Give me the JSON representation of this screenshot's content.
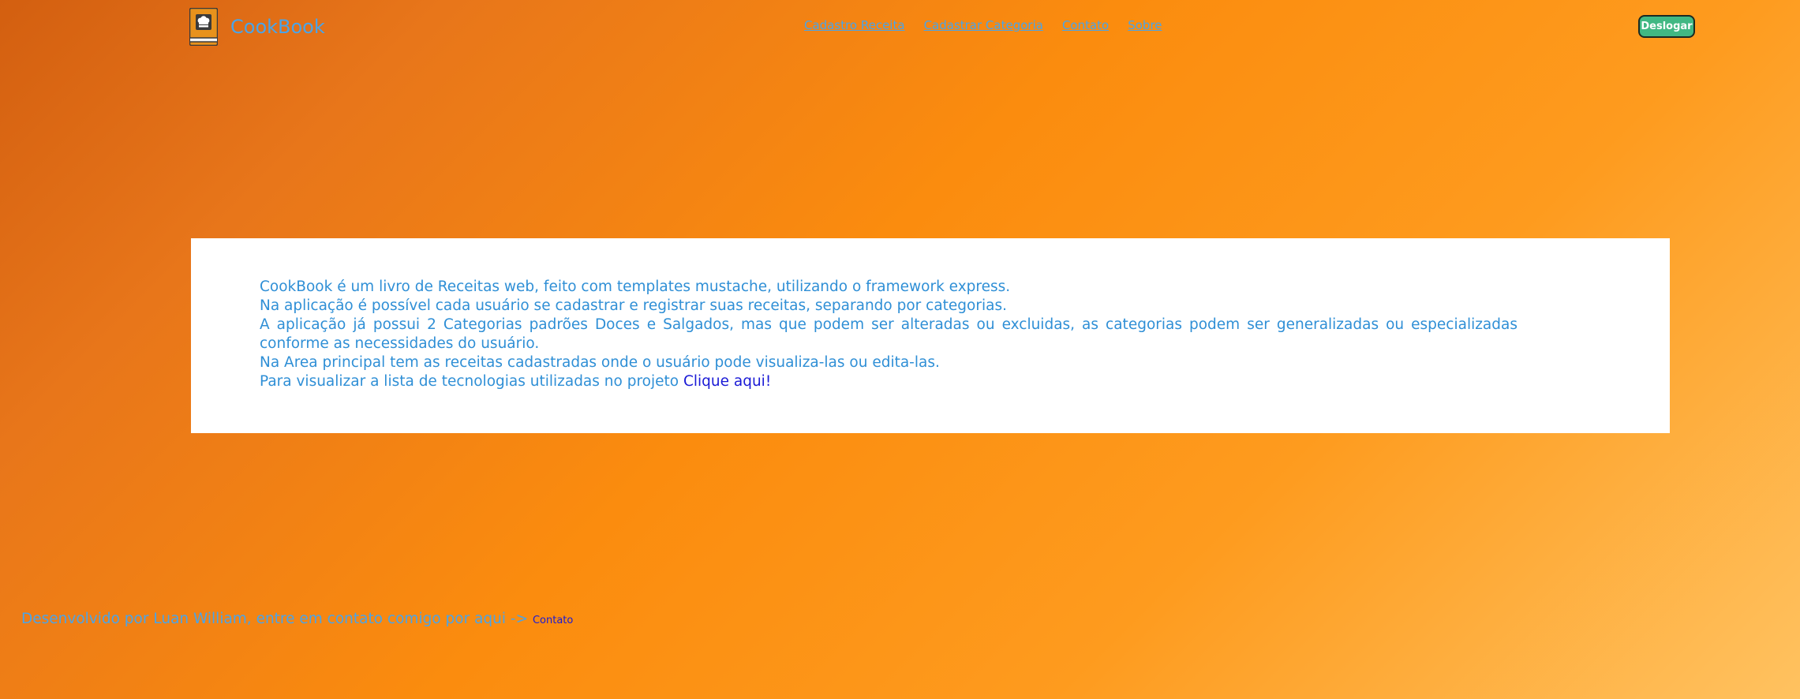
{
  "brand": {
    "name": "CookBook"
  },
  "nav": {
    "items": [
      {
        "label": "Cadastro Receita"
      },
      {
        "label": "Cadastrar Categoria"
      },
      {
        "label": "Contato"
      },
      {
        "label": "Sobre"
      }
    ],
    "logout_label": "Deslogar"
  },
  "main": {
    "lines": [
      "CookBook é um livro de Receitas web, feito com templates mustache, utilizando o framework express.",
      "Na aplicação é possível cada usuário se cadastrar e registrar suas receitas, separando por categorias.",
      "A aplicação já possui 2 Categorias padrões Doces e Salgados, mas que podem ser alteradas ou excluidas, as categorias podem ser generalizadas ou especializadas conforme as necessidades do usuário.",
      "Na Area principal tem as receitas cadastradas onde o usuário pode visualiza-las ou edita-las."
    ],
    "tech_prefix": "Para visualizar a lista de tecnologias utilizadas no projeto ",
    "tech_link": "Clique aqui!"
  },
  "footer": {
    "text": "Desenvolvido por Luan William, entre em contato comigo por aqui -> ",
    "link": "Contato"
  },
  "colors": {
    "brand_text": "#4aa4e8",
    "body_text": "#2f8fd6",
    "link": "#1a1ad6",
    "logout_bg": "#41b883",
    "background_gradient": [
      "#d35f10",
      "#fb8c0e",
      "#ffc260"
    ]
  },
  "icons": {
    "logo": "chef-hat-cookbook-icon"
  }
}
